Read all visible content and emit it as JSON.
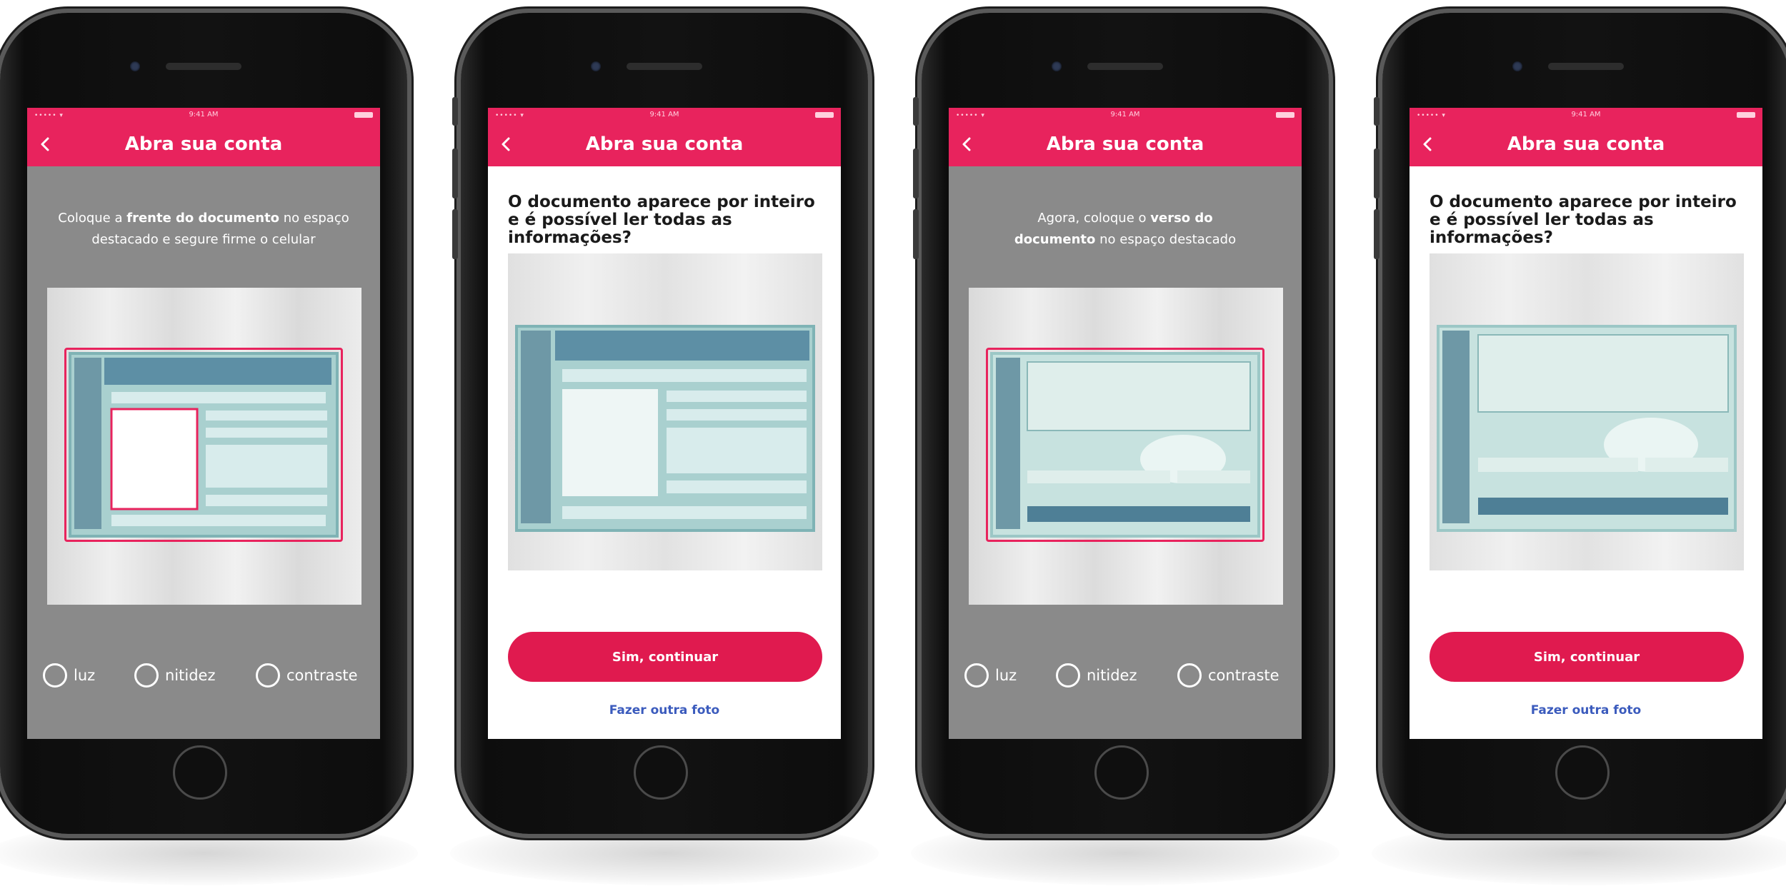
{
  "colors": {
    "accent": "#e8235d",
    "button": "#e01a4f",
    "link": "#3b5bbd",
    "overlay_gray": "#8a8a8a",
    "doc_green": "#5aa2a0"
  },
  "screens": [
    {
      "status": {
        "signal": "••••• ▾",
        "time": "9:41 AM"
      },
      "nav": {
        "title": "Abra sua conta",
        "back_icon": "chevron-left-icon"
      },
      "instruction": {
        "pre": "Coloque a ",
        "bold": "frente do documento",
        "post": " no espaço destacado e segure firme o celular"
      },
      "toggles": [
        "luz",
        "nitidez",
        "contraste"
      ]
    },
    {
      "status": {
        "signal": "••••• ▾",
        "time": "9:41 AM"
      },
      "nav": {
        "title": "Abra sua conta",
        "back_icon": "chevron-left-icon"
      },
      "question": "O documento aparece por inteiro e é possível ler todas as informações?",
      "primary_button": "Sim, continuar",
      "secondary_link": "Fazer outra foto"
    },
    {
      "status": {
        "signal": "••••• ▾",
        "time": "9:41 AM"
      },
      "nav": {
        "title": "Abra sua conta",
        "back_icon": "chevron-left-icon"
      },
      "instruction": {
        "pre": "Agora, coloque o ",
        "bold": "verso do documento",
        "post": " no espaço destacado"
      },
      "toggles": [
        "luz",
        "nitidez",
        "contraste"
      ]
    },
    {
      "status": {
        "signal": "••••• ▾",
        "time": "9:41 AM"
      },
      "nav": {
        "title": "Abra sua conta",
        "back_icon": "chevron-left-icon"
      },
      "question": "O documento aparece por inteiro e é possível ler todas as informações?",
      "primary_button": "Sim, continuar",
      "secondary_link": "Fazer outra foto"
    }
  ]
}
